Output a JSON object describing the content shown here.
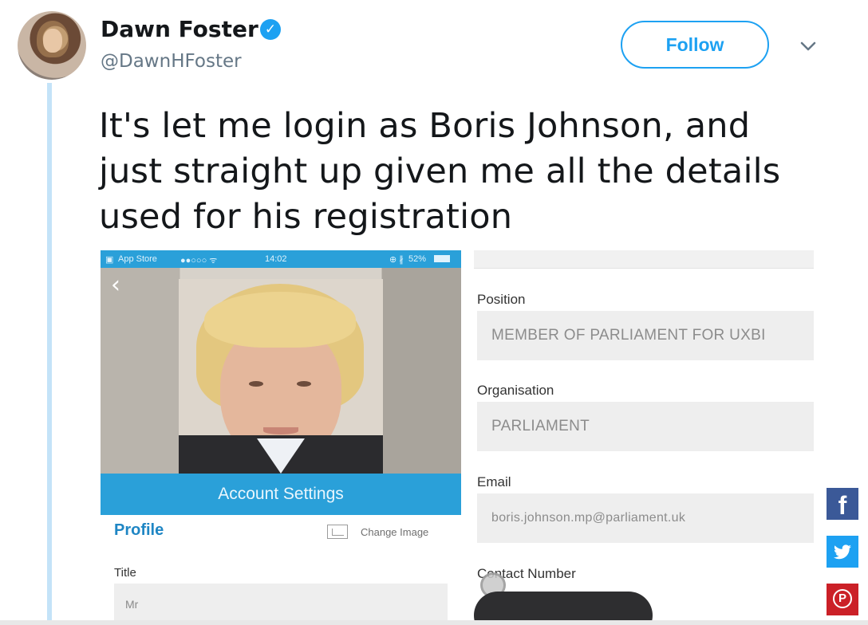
{
  "tweet": {
    "author_name": "Dawn Foster",
    "author_handle": "@DawnHFoster",
    "follow_label": "Follow",
    "text": "It's let me login as Boris Johnson, and just straight up given me all the details used for his registration"
  },
  "app_screenshot": {
    "status_bar": {
      "carrier": "App Store",
      "time": "14:02",
      "battery": "52%"
    },
    "account_settings_label": "Account Settings",
    "profile_label": "Profile",
    "change_image_label": "Change Image",
    "title_label": "Title",
    "title_value": "Mr",
    "position_label": "Position",
    "position_value": "MEMBER OF PARLIAMENT FOR UXBI",
    "organisation_label": "Organisation",
    "organisation_value": "PARLIAMENT",
    "email_label": "Email",
    "email_value": "boris.johnson.mp@parliament.uk",
    "contact_label": "Contact Number"
  },
  "share": {
    "facebook_glyph": "f",
    "twitter_icon": "twitter-bird-icon",
    "pinterest_glyph": "P"
  },
  "colors": {
    "twitter_blue": "#1da1f2",
    "app_blue": "#2aa0d9",
    "facebook": "#3b5998",
    "pinterest": "#cb2027"
  }
}
